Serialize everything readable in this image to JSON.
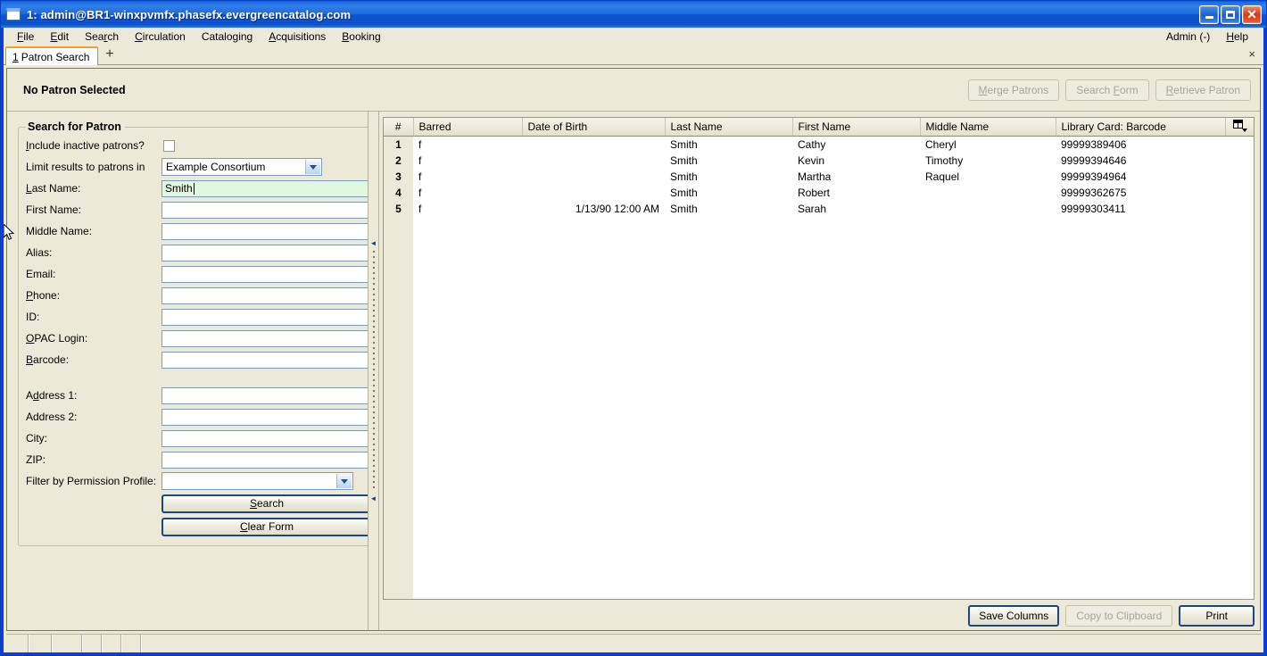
{
  "window": {
    "title": "1: admin@BR1-winxpvmfx.phasefx.evergreencatalog.com",
    "icon": "window-icon",
    "minimize": "_",
    "maximize": "□",
    "close": "✕"
  },
  "menubar": {
    "items": [
      {
        "label": "File",
        "accel": "F"
      },
      {
        "label": "Edit",
        "accel": "E"
      },
      {
        "label": "Search",
        "accel": "r"
      },
      {
        "label": "Circulation",
        "accel": "C"
      },
      {
        "label": "Cataloging",
        "accel": "g"
      },
      {
        "label": "Acquisitions",
        "accel": "A"
      },
      {
        "label": "Booking",
        "accel": "B"
      }
    ],
    "right": [
      {
        "label": "Admin (-)",
        "accel": ""
      },
      {
        "label": "Help",
        "accel": "H"
      }
    ]
  },
  "tabs": {
    "active": {
      "number": "1",
      "label": "Patron Search"
    },
    "add_label": "+",
    "close_label": "×"
  },
  "patron_header": {
    "title": "No Patron Selected",
    "buttons": [
      {
        "label": "Merge Patrons",
        "disabled": true
      },
      {
        "label": "Search Form",
        "disabled": true
      },
      {
        "label": "Retrieve Patron",
        "disabled": true
      }
    ]
  },
  "search_form": {
    "legend": "Search for Patron",
    "include_inactive_label": "Include inactive patrons?",
    "include_inactive_checked": false,
    "limit_label": "Limit results to patrons in",
    "limit_value": "Example Consortium",
    "fields": [
      {
        "label": "Last Name:",
        "value": "Smith",
        "placeholder": "",
        "active": true
      },
      {
        "label": "First Name:",
        "value": "",
        "placeholder": "",
        "active": false
      },
      {
        "label": "Middle Name:",
        "value": "",
        "placeholder": "",
        "active": false
      },
      {
        "label": "Alias:",
        "value": "",
        "placeholder": "",
        "active": false
      },
      {
        "label": "Email:",
        "value": "",
        "placeholder": "",
        "active": false
      },
      {
        "label": "Phone:",
        "value": "",
        "placeholder": "",
        "active": false
      },
      {
        "label": "ID:",
        "value": "",
        "placeholder": "",
        "active": false
      },
      {
        "label": "OPAC Login:",
        "value": "",
        "placeholder": "",
        "active": false
      },
      {
        "label": "Barcode:",
        "value": "",
        "placeholder": "",
        "active": false
      }
    ],
    "address_fields": [
      {
        "label": "Address 1:",
        "value": "",
        "placeholder": ""
      },
      {
        "label": "Address 2:",
        "value": "",
        "placeholder": ""
      },
      {
        "label": "City:",
        "value": "",
        "placeholder": ""
      },
      {
        "label": "ZIP:",
        "value": "",
        "placeholder": ""
      }
    ],
    "permission_label": "Filter by Permission Profile:",
    "permission_value": "",
    "search_button": "Search",
    "clear_button": "Clear Form"
  },
  "results": {
    "columns": [
      "#",
      "Barred",
      "Date of Birth",
      "Last Name",
      "First Name",
      "Middle Name",
      "Library Card: Barcode"
    ],
    "rows": [
      {
        "num": "1",
        "barred": "f",
        "dob": "",
        "last": "Smith",
        "first": "Cathy",
        "middle": "Cheryl",
        "barcode": "99999389406"
      },
      {
        "num": "2",
        "barred": "f",
        "dob": "",
        "last": "Smith",
        "first": "Kevin",
        "middle": "Timothy",
        "barcode": "99999394646"
      },
      {
        "num": "3",
        "barred": "f",
        "dob": "",
        "last": "Smith",
        "first": "Martha",
        "middle": "Raquel",
        "barcode": "99999394964"
      },
      {
        "num": "4",
        "barred": "f",
        "dob": "",
        "last": "Smith",
        "first": "Robert",
        "middle": "",
        "barcode": "99999362675"
      },
      {
        "num": "5",
        "barred": "f",
        "dob": "1/13/90 12:00 AM",
        "last": "Smith",
        "first": "Sarah",
        "middle": "",
        "barcode": "99999303411"
      }
    ],
    "column_picker_icon": "column-picker-icon",
    "actions": [
      {
        "label": "Save Columns",
        "disabled": false,
        "default": true
      },
      {
        "label": "Copy to Clipboard",
        "disabled": true,
        "default": false
      },
      {
        "label": "Print",
        "disabled": false,
        "default": true
      }
    ]
  },
  "colors": {
    "titlebar_blue": "#0b3fd8",
    "window_face": "#ece9d8",
    "field_border": "#7f9db9",
    "active_field_bg": "#e2f7e0",
    "tab_accent": "#f0a030",
    "default_button_border": "#21457c"
  }
}
